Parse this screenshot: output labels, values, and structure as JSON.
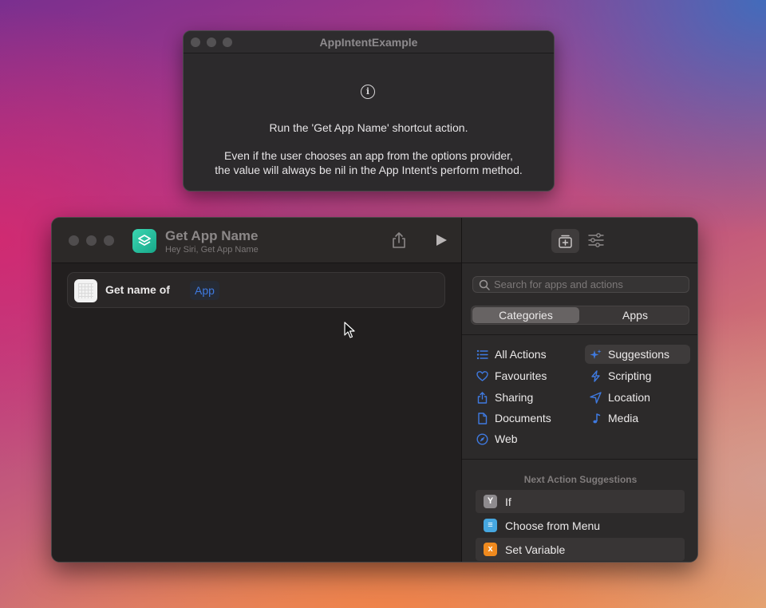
{
  "info_window": {
    "title": "AppIntentExample",
    "icon": "info-circle-icon",
    "line1": "Run the 'Get App Name' shortcut action.",
    "line2": "Even if the user chooses an app from the options provider,",
    "line3": "the value will always be nil in the App Intent's perform method."
  },
  "editor": {
    "title": "Get App Name",
    "subtitle": "Hey Siri, Get App Name",
    "action": {
      "label": "Get name of",
      "token": "App"
    }
  },
  "sidebar": {
    "search_placeholder": "Search for apps and actions",
    "tabs": [
      "Categories",
      "Apps"
    ],
    "active_tab": "Categories",
    "categories": [
      {
        "label": "All Actions",
        "icon": "list-icon"
      },
      {
        "label": "Suggestions",
        "icon": "sparkles-icon",
        "selected": true
      },
      {
        "label": "Favourites",
        "icon": "heart-icon"
      },
      {
        "label": "Scripting",
        "icon": "scripting-icon"
      },
      {
        "label": "Sharing",
        "icon": "share-icon"
      },
      {
        "label": "Location",
        "icon": "location-arrow-icon"
      },
      {
        "label": "Documents",
        "icon": "document-icon"
      },
      {
        "label": "Media",
        "icon": "music-note-icon"
      },
      {
        "label": "Web",
        "icon": "compass-icon"
      }
    ],
    "suggestions_heading": "Next Action Suggestions",
    "suggestions": [
      {
        "label": "If",
        "icon": "if-branch-icon",
        "color": "#8e8b8e"
      },
      {
        "label": "Choose from Menu",
        "icon": "menu-icon",
        "color": "#46a7e0"
      },
      {
        "label": "Set Variable",
        "icon": "variable-icon",
        "color": "#f08a1e"
      }
    ]
  },
  "colors": {
    "accent": "#3f7ae0",
    "app_icon": "#2cc4a0"
  }
}
